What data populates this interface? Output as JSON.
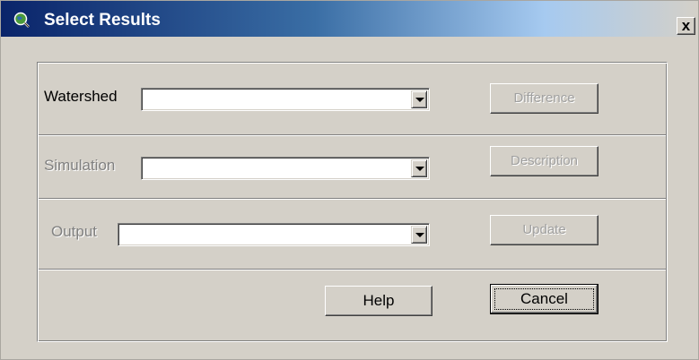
{
  "window": {
    "title": "Select Results",
    "close_glyph": "x"
  },
  "icons": {
    "app": "magnifier-globe-icon",
    "combo_arrow": "chevron-down-icon"
  },
  "form": {
    "watershed": {
      "label": "Watershed",
      "value": "",
      "enabled": true
    },
    "simulation": {
      "label": "Simulation",
      "value": "",
      "enabled": false
    },
    "output": {
      "label": "Output",
      "value": "",
      "enabled": false
    }
  },
  "buttons": {
    "difference": {
      "label": "Difference",
      "enabled": false
    },
    "description": {
      "label": "Description",
      "enabled": false
    },
    "update": {
      "label": "Update",
      "enabled": false
    },
    "help": {
      "label": "Help",
      "enabled": true
    },
    "cancel": {
      "label": "Cancel",
      "enabled": true,
      "focused": true
    }
  },
  "colors": {
    "dialog_bg": "#d4d0c8",
    "titlebar_start": "#0a246a",
    "titlebar_end": "#a6caf0",
    "disabled_text": "#808080"
  }
}
